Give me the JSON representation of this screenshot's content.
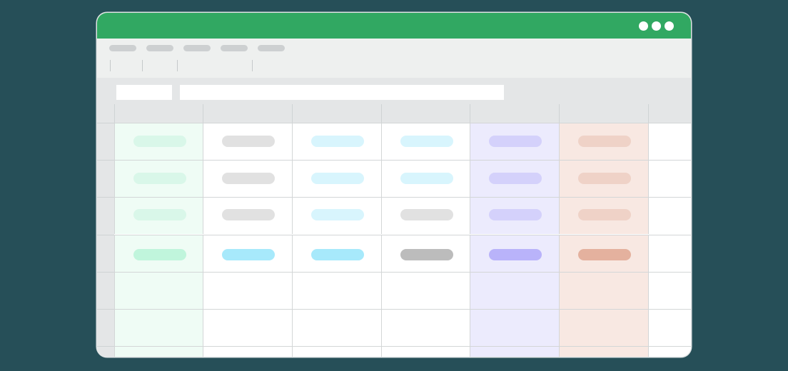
{
  "window": {
    "title_bar_color": "#31a862",
    "controls": [
      "dot-icon",
      "dot-icon",
      "dot-icon"
    ]
  },
  "menu": {
    "items": [
      "",
      "",
      "",
      "",
      ""
    ]
  },
  "formula_bar": {
    "name_box_value": "",
    "formula_value": ""
  },
  "sheet": {
    "columns": [
      "",
      "",
      "",
      "",
      "",
      "",
      ""
    ],
    "rows": 7,
    "column_fills": [
      "#effcf5",
      "#ffffff",
      "#ffffff",
      "#ffffff",
      "#ecebfd",
      "#f8e8e2",
      "#ffffff"
    ],
    "placeholder_rows": [
      [
        "#d9f7e9",
        "#e1e1e1",
        "#d8f5fd",
        "#d8f5fd",
        "#d4d1fb",
        "#efd2c7"
      ],
      [
        "#d9f7e9",
        "#e1e1e1",
        "#d8f5fd",
        "#d8f5fd",
        "#d4d1fb",
        "#efd2c7"
      ],
      [
        "#d9f7e9",
        "#e1e1e1",
        "#d8f5fd",
        "#e1e1e1",
        "#d4d1fb",
        "#efd2c7"
      ],
      [
        "#c0f5dc",
        "#a7e9fb",
        "#a7e9fb",
        "#bcbcbc",
        "#b9b3fa",
        "#e4b19e"
      ]
    ]
  }
}
